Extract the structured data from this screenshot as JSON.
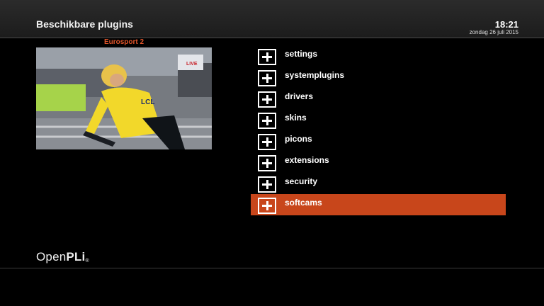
{
  "header": {
    "title": "Beschikbare plugins",
    "time": "18:21",
    "date": "zondag 26 juli 2015"
  },
  "preview": {
    "channel": "Eurosport 2",
    "overlay_badge": "LIVE",
    "jersey_text": "LCL"
  },
  "menu": {
    "items": [
      {
        "label": "settings",
        "icon": "plus-icon"
      },
      {
        "label": "systemplugins",
        "icon": "plus-icon"
      },
      {
        "label": "drivers",
        "icon": "plus-icon"
      },
      {
        "label": "skins",
        "icon": "plus-icon"
      },
      {
        "label": "picons",
        "icon": "plus-icon"
      },
      {
        "label": "extensions",
        "icon": "plus-icon"
      },
      {
        "label": "security",
        "icon": "plus-icon"
      },
      {
        "label": "softcams",
        "icon": "plus-icon"
      }
    ],
    "selected_index": 7
  },
  "footer": {
    "logo_part1": "Open",
    "logo_part2": "PLi",
    "logo_mark": "®"
  },
  "colors": {
    "accent": "#c8461b",
    "channel": "#e0542a",
    "background": "#000000"
  }
}
